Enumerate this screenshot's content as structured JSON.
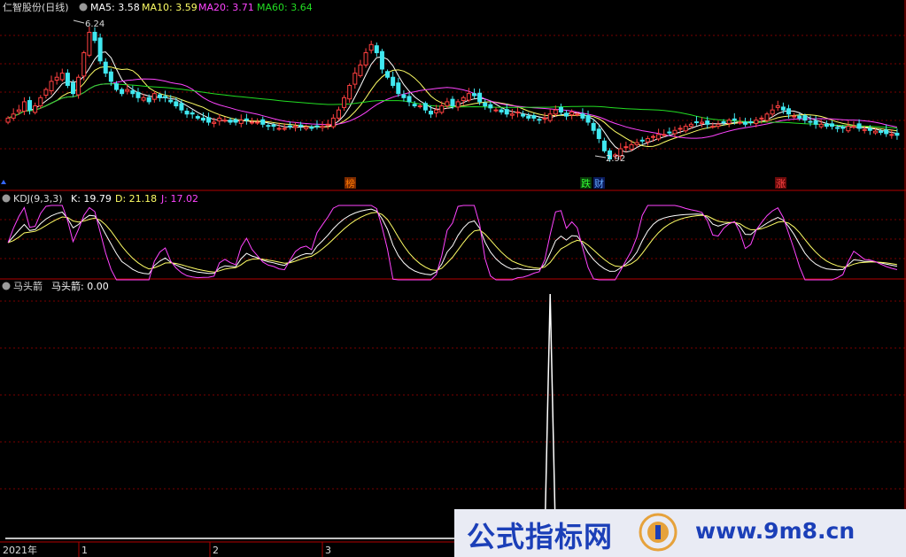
{
  "panels": {
    "main": {
      "title": "仁智股份(日线)",
      "indicators": [
        {
          "label": "MA5: 3.58",
          "color": "#ffffff"
        },
        {
          "label": "MA10: 3.59",
          "color": "#ffff66"
        },
        {
          "label": "MA20: 3.71",
          "color": "#ff44ff"
        },
        {
          "label": "MA60: 3.64",
          "color": "#22dd22"
        }
      ],
      "high_label": "6.24",
      "low_label": "2.92",
      "markers": [
        {
          "text": "榜",
          "color": "#ff7a00",
          "bg": "#7a2a00"
        },
        {
          "text": "跌",
          "color": "#33ff33",
          "bg": "#0a3a0a"
        },
        {
          "text": "财",
          "color": "#66aaff",
          "bg": "#0a1a5a"
        },
        {
          "text": "涨",
          "color": "#ff4444",
          "bg": "#6a0a0a"
        }
      ]
    },
    "kdj": {
      "title": "KDJ(9,3,3)",
      "indicators": [
        {
          "label": "K: 19.79",
          "color": "#ffffff"
        },
        {
          "label": "D: 21.18",
          "color": "#ffff66"
        },
        {
          "label": "J: 17.02",
          "color": "#ff44ff"
        }
      ]
    },
    "arrow": {
      "title": "马头箭",
      "indicators": [
        {
          "label": "马头箭: 0.00",
          "color": "#ffffff"
        }
      ]
    }
  },
  "time_axis": [
    "2021年",
    "1",
    "2",
    "3"
  ],
  "watermark": {
    "text": "公式指标网",
    "url": "www.9m8.cn"
  },
  "colors": {
    "up": "#ff4040",
    "down": "#40e8f0",
    "grid": "#7a0000",
    "separator": "#b00000"
  },
  "chart_data": [
    {
      "type": "candlestick",
      "title": "仁智股份(日线)",
      "high": 6.24,
      "low": 2.92,
      "y_range": [
        2.6,
        6.5
      ],
      "close": [
        4.0,
        4.1,
        4.2,
        4.4,
        4.2,
        4.3,
        4.5,
        4.7,
        4.9,
        5.0,
        5.1,
        4.8,
        4.6,
        5.0,
        5.6,
        6.1,
        5.9,
        5.4,
        5.1,
        4.9,
        4.7,
        4.6,
        4.7,
        4.6,
        4.5,
        4.5,
        4.4,
        4.6,
        4.5,
        4.5,
        4.4,
        4.3,
        4.2,
        4.1,
        4.1,
        4.0,
        3.95,
        3.9,
        3.9,
        4.0,
        3.95,
        3.9,
        3.9,
        3.95,
        3.95,
        3.9,
        3.9,
        3.85,
        3.8,
        3.8,
        3.75,
        3.75,
        3.8,
        3.8,
        3.8,
        3.78,
        3.75,
        3.8,
        3.8,
        3.85,
        4.0,
        4.2,
        4.5,
        4.8,
        5.1,
        5.3,
        5.6,
        5.8,
        5.6,
        5.2,
        5.0,
        4.8,
        4.6,
        4.5,
        4.4,
        4.3,
        4.3,
        4.2,
        4.1,
        4.2,
        4.3,
        4.4,
        4.3,
        4.4,
        4.5,
        4.6,
        4.55,
        4.4,
        4.3,
        4.25,
        4.2,
        4.15,
        4.1,
        4.1,
        4.15,
        4.05,
        4.0,
        4.0,
        3.95,
        4.0,
        4.1,
        4.2,
        4.15,
        4.05,
        4.15,
        4.1,
        4.0,
        3.9,
        3.7,
        3.5,
        3.2,
        3.0,
        3.1,
        3.25,
        3.3,
        3.35,
        3.4,
        3.45,
        3.5,
        3.55,
        3.6,
        3.6,
        3.65,
        3.7,
        3.75,
        3.8,
        3.85,
        3.9,
        3.9,
        3.85,
        3.8,
        3.85,
        3.9,
        3.95,
        3.95,
        3.9,
        3.85,
        3.9,
        3.95,
        4.0,
        4.1,
        4.2,
        4.3,
        4.2,
        4.1,
        4.05,
        4.0,
        3.95,
        3.9,
        3.85,
        3.85,
        3.8,
        3.8,
        3.75,
        3.75,
        3.8,
        3.8,
        3.75,
        3.72,
        3.7,
        3.68,
        3.65,
        3.62,
        3.6,
        3.58
      ],
      "ma_latest": {
        "MA5": 3.58,
        "MA10": 3.59,
        "MA20": 3.71,
        "MA60": 3.64
      }
    },
    {
      "type": "line",
      "title": "KDJ(9,3,3)",
      "series": [
        {
          "name": "K",
          "latest": 19.79
        },
        {
          "name": "D",
          "latest": 21.18
        },
        {
          "name": "J",
          "latest": 17.02
        }
      ]
    },
    {
      "type": "line",
      "title": "马头箭",
      "series": [
        {
          "name": "马头箭",
          "latest": 0.0,
          "spike_index": 100,
          "spike_value": 1.0
        }
      ]
    }
  ]
}
